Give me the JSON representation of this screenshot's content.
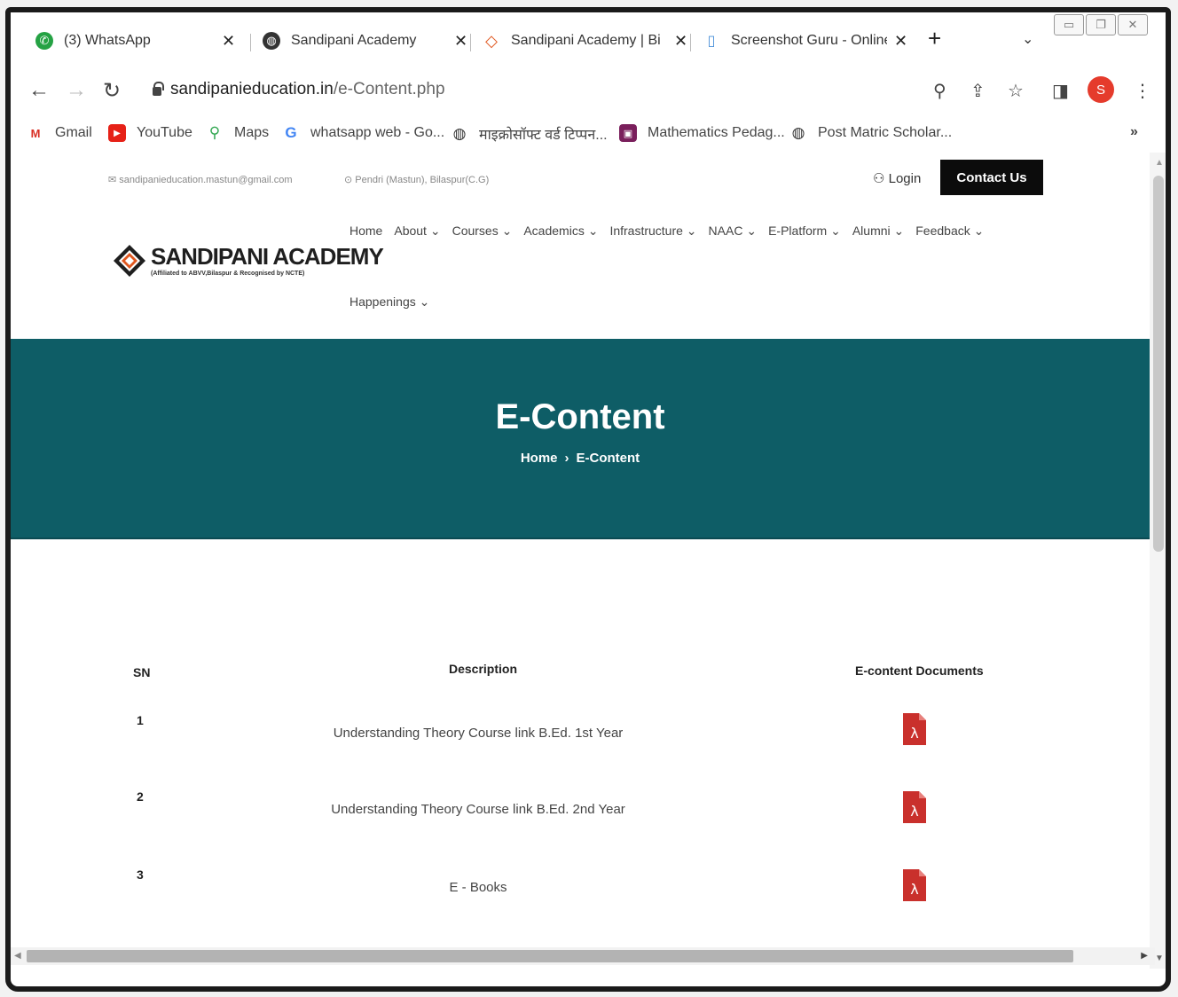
{
  "browser": {
    "tabs": [
      {
        "label": "(3) WhatsApp",
        "icon": "whatsapp-icon",
        "color": "#25a244"
      },
      {
        "label": "Sandipani Academy",
        "icon": "globe-icon",
        "color": "#333333"
      },
      {
        "label": "Sandipani Academy | Bi",
        "icon": "sandipani-logo-icon",
        "color": "#e0571f"
      },
      {
        "label": "Screenshot Guru - Online",
        "icon": "file-icon",
        "color": "#4a90d9"
      }
    ],
    "new_tab": "+",
    "tab_menu": "⌄",
    "url_host": "sandipanieducation.in",
    "url_path": "/e-Content.php",
    "avatar_letter": "S",
    "bookmarks": [
      {
        "label": "Gmail",
        "icon": "gmail-icon"
      },
      {
        "label": "YouTube",
        "icon": "youtube-icon"
      },
      {
        "label": "Maps",
        "icon": "maps-icon"
      },
      {
        "label": "whatsapp web - Go...",
        "icon": "google-icon"
      },
      {
        "label": "माइक्रोसॉफ्ट वर्ड टिप्पन...",
        "icon": "globe-icon"
      },
      {
        "label": "Mathematics Pedag...",
        "icon": "bookmark-app-icon"
      },
      {
        "label": "Post Matric Scholar...",
        "icon": "globe-icon"
      }
    ],
    "more_bookmarks": "»"
  },
  "site": {
    "email": "sandipanieducation.mastun@gmail.com",
    "address": "Pendri (Mastun), Bilaspur(C.G)",
    "login": "Login",
    "contact": "Contact Us",
    "logo_title": "SANDIPANI ACADEMY",
    "logo_tagline": "(Affiliated to ABVV,Bilaspur & Recognised by NCTE)",
    "menu": [
      "Home",
      "About ⌄",
      "Courses ⌄",
      "Academics ⌄",
      "Infrastructure ⌄",
      "NAAC ⌄",
      "E-Platform ⌄",
      "Alumni ⌄",
      "Feedback ⌄"
    ],
    "menu_second_row": "Happenings ⌄",
    "banner_title": "E-Content",
    "breadcrumb_home": "Home",
    "breadcrumb_sep": "›",
    "breadcrumb_current": "E-Content",
    "brand_color": "#0e5d66"
  },
  "table": {
    "headers": {
      "sn": "SN",
      "description": "Description",
      "documents": "E-content Documents"
    },
    "rows": [
      {
        "sn": "1",
        "description": "Understanding Theory Course link B.Ed. 1st Year",
        "doc_icon": "pdf-icon"
      },
      {
        "sn": "2",
        "description": "Understanding Theory Course link B.Ed. 2nd Year",
        "doc_icon": "pdf-icon"
      },
      {
        "sn": "3",
        "description": "E - Books",
        "doc_icon": "pdf-icon"
      }
    ]
  }
}
